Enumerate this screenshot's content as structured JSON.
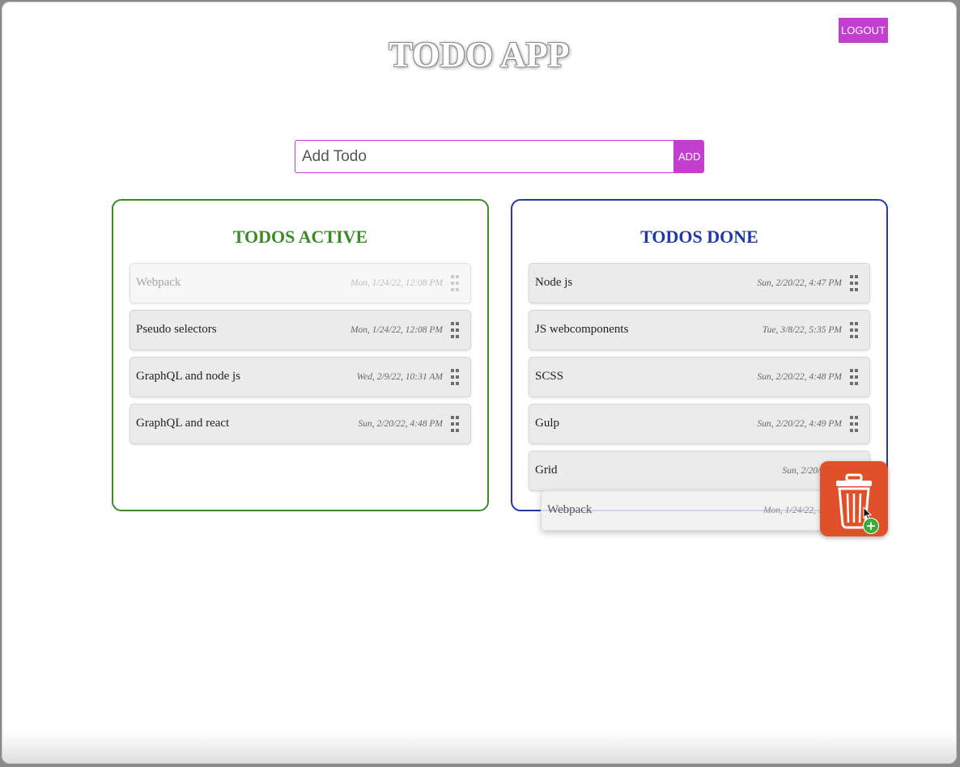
{
  "header": {
    "title": "TODO APP",
    "logout_label": "LOGOUT"
  },
  "add_form": {
    "placeholder": "Add Todo",
    "value": "",
    "add_label": "ADD"
  },
  "active": {
    "title": "TODOS ACTIVE",
    "items": [
      {
        "title": "Webpack",
        "date": "Mon, 1/24/22, 12:08 PM",
        "state": "drag-source-ghost"
      },
      {
        "title": "Pseudo selectors",
        "date": "Mon, 1/24/22, 12:08 PM"
      },
      {
        "title": "GraphQL and node js",
        "date": "Wed, 2/9/22, 10:31 AM"
      },
      {
        "title": "GraphQL and react",
        "date": "Sun, 2/20/22, 4:48 PM"
      }
    ]
  },
  "done": {
    "title": "TODOS DONE",
    "items": [
      {
        "title": "Node js",
        "date": "Sun, 2/20/22, 4:47 PM"
      },
      {
        "title": "JS webcomponents",
        "date": "Tue, 3/8/22, 5:35 PM"
      },
      {
        "title": "SCSS",
        "date": "Sun, 2/20/22, 4:48 PM"
      },
      {
        "title": "Gulp",
        "date": "Sun, 2/20/22, 4:49 PM"
      },
      {
        "title": "Grid",
        "date": "Sun, 2/20/22, 4:"
      }
    ]
  },
  "drag_preview": {
    "title": "Webpack",
    "date": "Mon, 1/24/22, 12:08 PM"
  },
  "colors": {
    "accent": "#c43fd0",
    "active_green": "#3a8a28",
    "done_blue": "#2339a8",
    "trash_orange": "#e0502a",
    "copy_badge_green": "#3cab3a"
  },
  "icons": {
    "drag_handle": "drag-handle-icon",
    "trash": "trash-icon",
    "copy_plus": "plus-badge-icon",
    "cursor": "cursor-arrow-icon"
  }
}
